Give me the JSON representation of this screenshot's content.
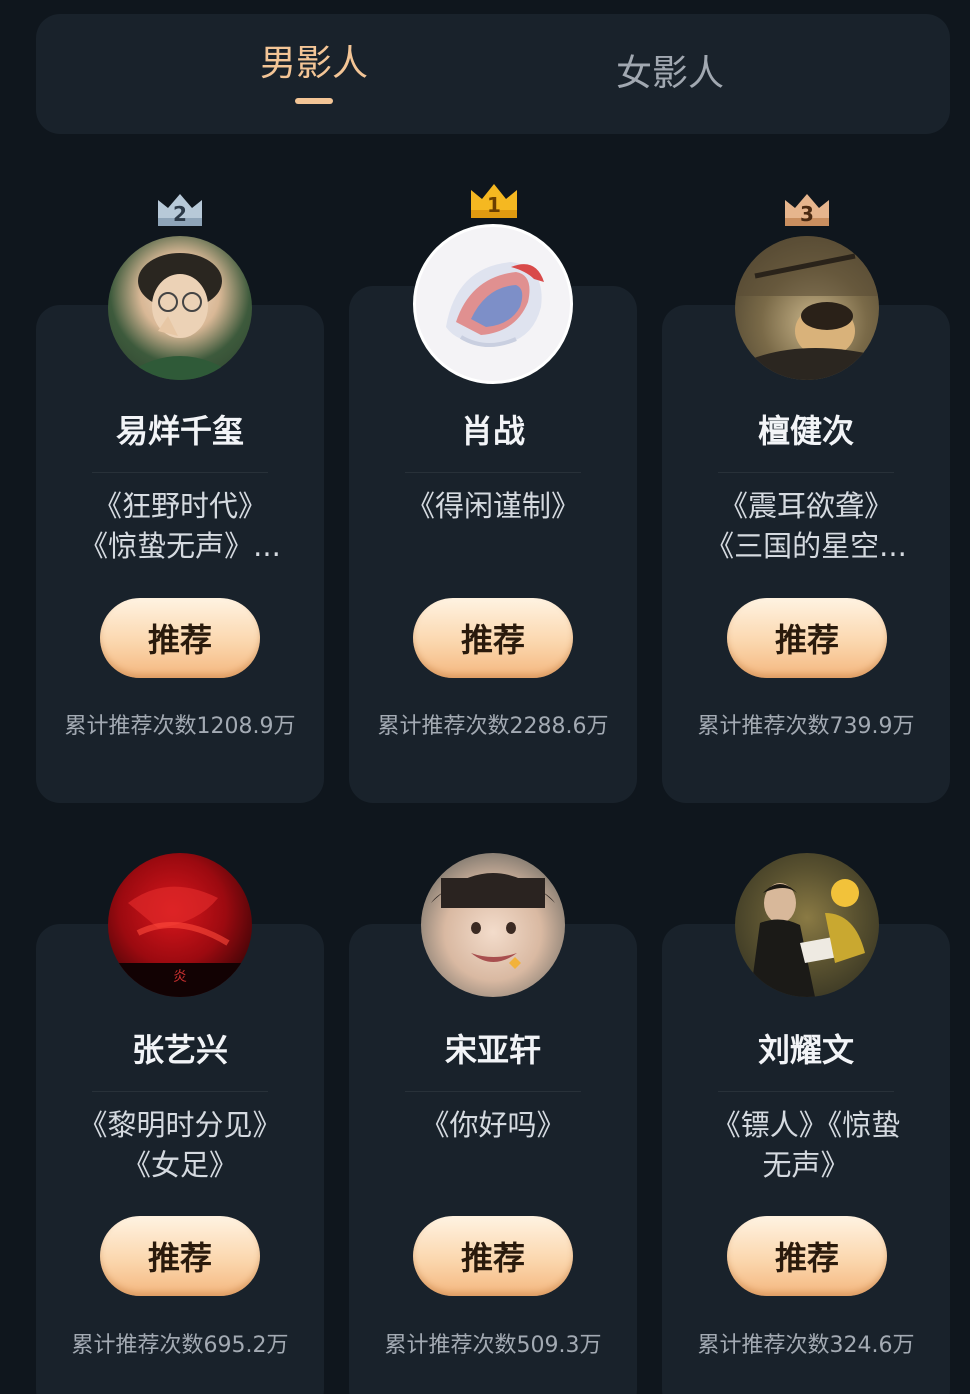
{
  "tabs": {
    "male": "男影人",
    "female": "女影人"
  },
  "button_label": "推荐",
  "cards": [
    {
      "rank": "2",
      "name": "易烊千玺",
      "works": [
        "《狂野时代》",
        "《惊蛰无声》..."
      ],
      "count": "累计推荐次数1208.9万"
    },
    {
      "rank": "1",
      "name": "肖战",
      "works": [
        "《得闲谨制》"
      ],
      "count": "累计推荐次数2288.6万"
    },
    {
      "rank": "3",
      "name": "檀健次",
      "works": [
        "《震耳欲聋》",
        "《三国的星空..."
      ],
      "count": "累计推荐次数739.9万"
    },
    {
      "name": "张艺兴",
      "works": [
        "《黎明时分见》",
        "《女足》"
      ],
      "count": "累计推荐次数695.2万"
    },
    {
      "name": "宋亚轩",
      "works": [
        "《你好吗》"
      ],
      "count": "累计推荐次数509.3万"
    },
    {
      "name": "刘耀文",
      "works": [
        "《镖人》《惊蛰",
        "无声》"
      ],
      "count": "累计推荐次数324.6万"
    }
  ],
  "colors": {
    "background": "#0f161d",
    "card": "#19222b",
    "accent": "#f3c596",
    "gold": "#f5b821",
    "silver": "#b7c9d8",
    "bronze": "#e6b58d"
  },
  "icons": [
    "crown-silver-icon",
    "crown-gold-icon",
    "crown-bronze-icon"
  ]
}
